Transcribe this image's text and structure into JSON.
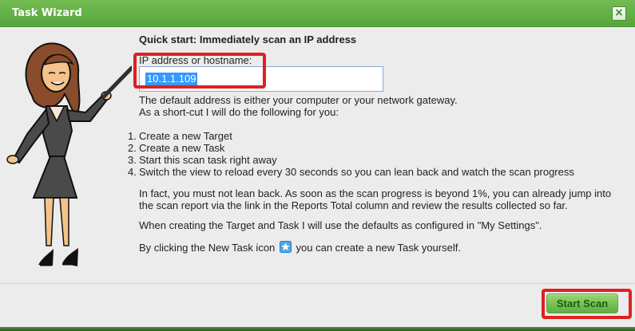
{
  "window": {
    "title": "Task Wizard",
    "close_symbol": "×"
  },
  "wizard": {
    "heading": "Quick start: Immediately scan an IP address",
    "field_label": "IP address or hostname:",
    "ip_value": "10.1.1.109",
    "description_line1": "The default address is either your computer or your network gateway.",
    "description_line2": "As a short-cut I will do the following for you:",
    "steps": [
      {
        "number": "1.",
        "text": "Create a new Target"
      },
      {
        "number": "2.",
        "text": "Create a new Task"
      },
      {
        "number": "3.",
        "text": "Start this scan task right away"
      },
      {
        "number": "4.",
        "text": "Switch the view to reload every 30 seconds so you can lean back and watch the scan progress"
      }
    ],
    "lean_back_text": "In fact, you must not lean back. As soon as the scan progress is beyond 1%, you can already jump into the scan report via the link in the Reports Total column and review the results collected so far.",
    "defaults_text": "When creating the Target and Task I will use the defaults as configured in \"My Settings\".",
    "new_task_prefix": "By clicking the New Task icon",
    "new_task_suffix": "you can create a new Task yourself."
  },
  "footer": {
    "start_scan_label": "Start Scan"
  },
  "icons": {
    "close": "close-icon",
    "new_task": "new-task-star-icon",
    "illustration": "presenter-woman-illustration"
  },
  "colors": {
    "titlebar_green": "#63b148",
    "button_green": "#7fc45a",
    "annotation_red": "#e0201f",
    "selection_blue": "#3399ff"
  }
}
